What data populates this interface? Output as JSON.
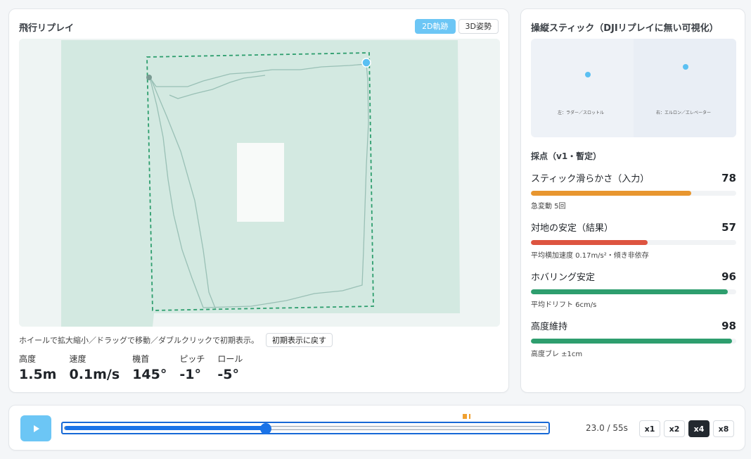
{
  "replay": {
    "title": "飛行リプレイ",
    "view_modes": [
      {
        "label": "2D軌跡",
        "active": true
      },
      {
        "label": "3D姿勢",
        "active": false
      }
    ],
    "map_hint": "ホイールで拡大縮小／ドラッグで移動／ダブルクリックで初期表示。",
    "reset_label": "初期表示に戻す",
    "telemetry": [
      {
        "label": "高度",
        "value": "1.5m"
      },
      {
        "label": "速度",
        "value": "0.1m/s"
      },
      {
        "label": "機首",
        "value": "145°"
      },
      {
        "label": "ピッチ",
        "value": "-1°"
      },
      {
        "label": "ロール",
        "value": "-5°"
      }
    ],
    "colors": {
      "path_dashed": "#2e9e6e",
      "track_line": "#8fb9ae",
      "area_fill": "#d3e9e1",
      "current_position": "#5bc0f2"
    }
  },
  "sticks": {
    "title": "操縦スティック（DJIリプレイに無い可視化）",
    "left_label": "左：ラダー／スロットル",
    "right_label": "右：エルロン／エレベーター"
  },
  "scoring": {
    "heading": "採点（v1・暫定）",
    "items": [
      {
        "label": "スティック滑らかさ（入力）",
        "score": 78,
        "note": "急変動 5回",
        "fill": 0.78,
        "color": "#e8962f"
      },
      {
        "label": "対地の安定（結果）",
        "score": 57,
        "note": "平均横加速度 0.17m/s²・傾き非依存",
        "fill": 0.57,
        "color": "#dd5440"
      },
      {
        "label": "ホバリング安定",
        "score": 96,
        "note": "平均ドリフト 6cm/s",
        "fill": 0.96,
        "color": "#2e9e6e"
      },
      {
        "label": "高度維持",
        "score": 98,
        "note": "高度ブレ ±1cm",
        "fill": 0.98,
        "color": "#2e9e6e"
      }
    ]
  },
  "playback": {
    "progress": 0.4182,
    "time_text": "23.0 / 55s",
    "speeds": [
      {
        "label": "x1",
        "active": false
      },
      {
        "label": "x2",
        "active": false
      },
      {
        "label": "x4",
        "active": true
      },
      {
        "label": "x8",
        "active": false
      }
    ],
    "accent": "#1a73e8",
    "event_color": "#f0a030"
  }
}
